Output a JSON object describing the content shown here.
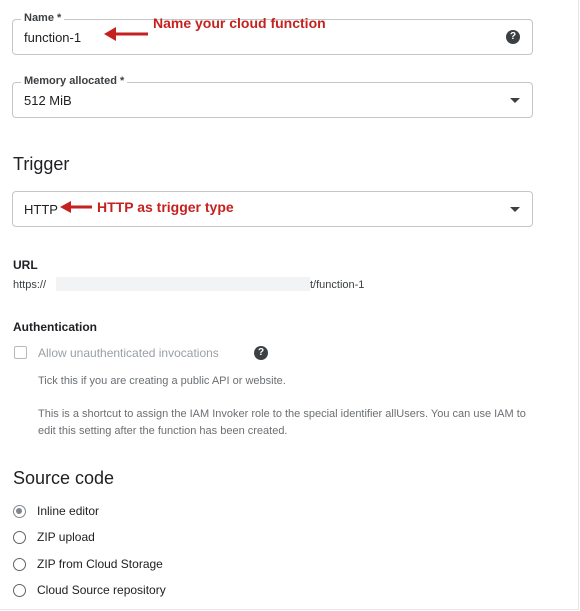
{
  "fields": {
    "name": {
      "label": "Name *",
      "value": "function-1",
      "help": "?"
    },
    "memory": {
      "label": "Memory allocated *",
      "value": "512 MiB"
    },
    "trigger": {
      "value": "HTTP"
    }
  },
  "annotations": {
    "name_note": "Name your cloud function",
    "trigger_note": "HTTP as trigger type"
  },
  "trigger_section": {
    "heading": "Trigger"
  },
  "url_section": {
    "label": "URL",
    "url_prefix": "https://",
    "url_suffix": "t/function-1"
  },
  "auth_section": {
    "heading": "Authentication",
    "checkbox_label": "Allow unauthenticated invocations",
    "help": "?",
    "hint1": "Tick this if you are creating a public API or website.",
    "hint2": "This is a shortcut to assign the IAM Invoker role to the special identifier allUsers. You can use IAM to edit this setting after the function has been created."
  },
  "source_code": {
    "heading": "Source code",
    "options": [
      {
        "label": "Inline editor",
        "selected": true
      },
      {
        "label": "ZIP upload",
        "selected": false
      },
      {
        "label": "ZIP from Cloud Storage",
        "selected": false
      },
      {
        "label": "Cloud Source repository",
        "selected": false
      }
    ]
  },
  "colors": {
    "annotation": "#c5221f",
    "border": "#c4c7c5",
    "text": "#202124"
  }
}
